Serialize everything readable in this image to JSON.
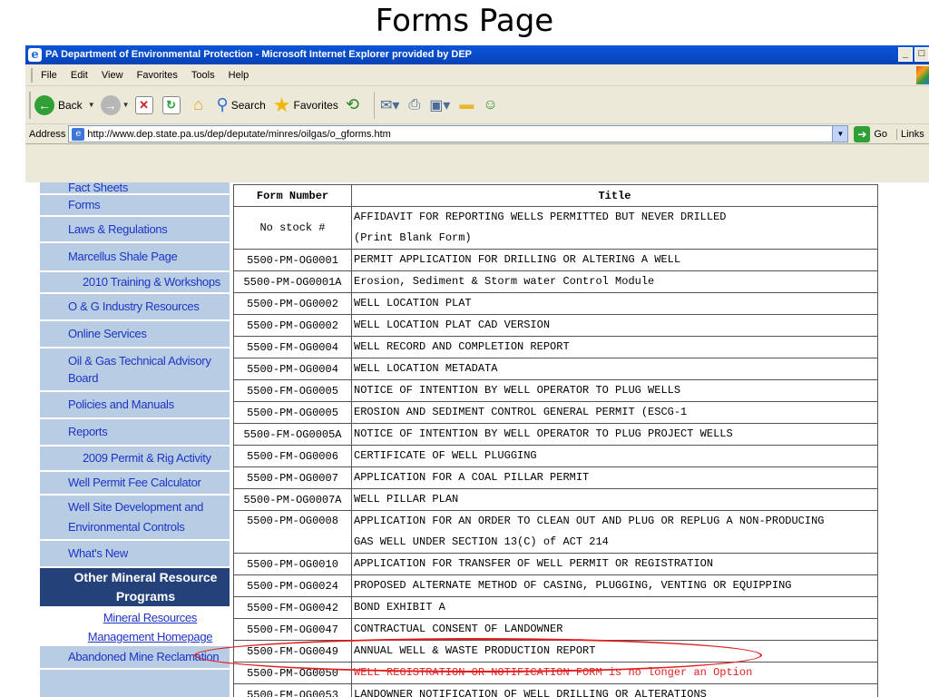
{
  "slide": {
    "title": "Forms Page"
  },
  "window": {
    "title": "PA Department of Environmental Protection - Microsoft Internet Explorer provided by DEP",
    "controls": {
      "minimize": "_",
      "restore": "□"
    }
  },
  "menu": [
    "File",
    "Edit",
    "View",
    "Favorites",
    "Tools",
    "Help"
  ],
  "toolbar": {
    "back_label": "Back",
    "search_label": "Search",
    "favorites_label": "Favorites"
  },
  "addressbar": {
    "label": "Address",
    "url": "http://www.dep.state.pa.us/dep/deputate/minres/oilgas/o_gforms.htm",
    "go_label": "Go",
    "links_label": "Links"
  },
  "sidebar": {
    "items": [
      "Fact Sheets",
      "Forms",
      "Laws & Regulations",
      "Marcellus Shale Page",
      "2010 Training & Workshops",
      "O & G Industry Resources",
      "Online Services",
      "Oil & Gas Technical Advisory Board",
      "Policies and Manuals",
      "Reports",
      "2009 Permit & Rig Activity",
      "Well Permit Fee Calculator",
      "Well Site Development and Environmental Controls",
      "What's New"
    ],
    "section_header": "Other Mineral Resource Programs",
    "sub_link": "Mineral Resources Management Homepage",
    "cut_link": "Abandoned Mine Reclamation"
  },
  "table": {
    "headers": {
      "number": "Form Number",
      "title": "Title"
    },
    "rows": [
      {
        "number": "No stock #",
        "title": "AFFIDAVIT FOR REPORTING WELLS PERMITTED BUT NEVER DRILLED",
        "title2": "(Print Blank Form)"
      },
      {
        "number": "5500-PM-OG0001",
        "title": "PERMIT APPLICATION FOR DRILLING OR ALTERING A WELL"
      },
      {
        "number": "5500-PM-OG0001A",
        "title": "Erosion, Sediment & Storm water Control Module"
      },
      {
        "number": "5500-PM-OG0002",
        "title": "WELL LOCATION PLAT"
      },
      {
        "number": "5500-PM-OG0002",
        "title": "WELL LOCATION PLAT CAD VERSION"
      },
      {
        "number": "5500-FM-OG0004",
        "title": "WELL RECORD AND COMPLETION REPORT"
      },
      {
        "number": "5500-PM-OG0004",
        "title": "WELL LOCATION METADATA"
      },
      {
        "number": "5500-FM-OG0005",
        "title": "NOTICE OF INTENTION BY WELL OPERATOR TO PLUG WELLS"
      },
      {
        "number": "5500-PM-OG0005",
        "title": "EROSION AND SEDIMENT CONTROL GENERAL PERMIT (ESCG-1"
      },
      {
        "number": "5500-FM-OG0005A",
        "title": "NOTICE OF INTENTION BY WELL OPERATOR TO PLUG PROJECT WELLS"
      },
      {
        "number": "5500-FM-OG0006",
        "title": "CERTIFICATE OF WELL PLUGGING"
      },
      {
        "number": "5500-PM-OG0007",
        "title": "APPLICATION FOR A COAL PILLAR PERMIT"
      },
      {
        "number": "5500-PM-OG0007A",
        "title": "WELL PILLAR PLAN"
      },
      {
        "number": "5500-PM-OG0008",
        "title": "APPLICATION FOR AN ORDER TO CLEAN OUT AND PLUG OR REPLUG A NON-PRODUCING",
        "title2": "GAS WELL UNDER SECTION 13(C) of ACT 214"
      },
      {
        "number": "5500-PM-OG0010",
        "title": "APPLICATION FOR TRANSFER OF WELL PERMIT OR REGISTRATION"
      },
      {
        "number": "5500-PM-OG0024",
        "title": "PROPOSED ALTERNATE METHOD OF CASING, PLUGGING, VENTING OR EQUIPPING"
      },
      {
        "number": "5500-FM-OG0042",
        "title": "BOND EXHIBIT A"
      },
      {
        "number": "5500-FM-OG0047",
        "title": "CONTRACTUAL CONSENT OF LANDOWNER"
      },
      {
        "number": "5500-FM-OG0049",
        "title": "ANNUAL WELL & WASTE PRODUCTION REPORT"
      },
      {
        "number": "5500-PM-OG0050",
        "title": "WELL REGISTRATION OR NOTIFICATION FORM is no longer an Option"
      },
      {
        "number": "5500-FM-OG0053",
        "title": "LANDOWNER NOTIFICATION OF WELL DRILLING OR ALTERATIONS"
      }
    ]
  },
  "colors": {
    "sidebar_bg": "#b8cde3",
    "sidebar_link": "#1c34c8",
    "section_header_bg": "#24417a",
    "highlight": "#e02020",
    "titlebar": "#0a55d8"
  }
}
